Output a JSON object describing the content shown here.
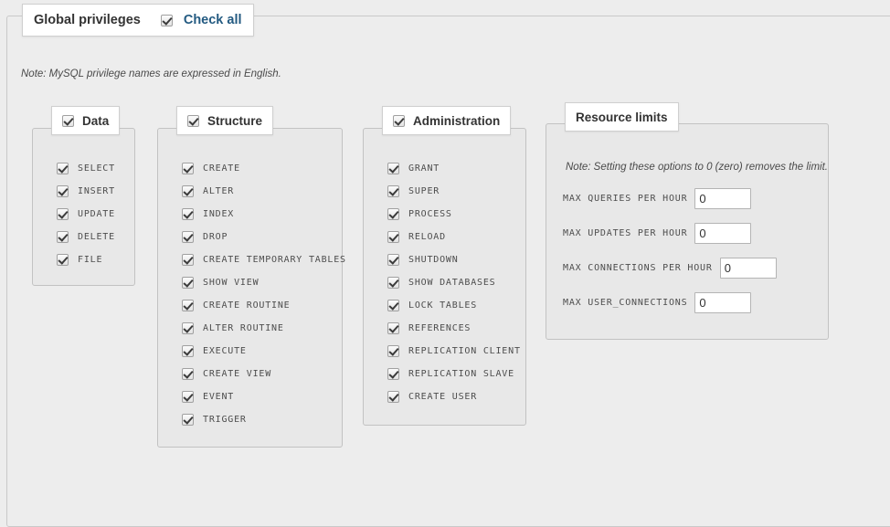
{
  "global": {
    "legend_title": "Global privileges",
    "check_all_label": "Check all",
    "check_all_checked": true,
    "note": "Note: MySQL privilege names are expressed in English."
  },
  "groups": [
    {
      "key": "data",
      "legend_title": "Data",
      "legend_checked": true,
      "items": [
        {
          "label": "SELECT",
          "checked": true
        },
        {
          "label": "INSERT",
          "checked": true
        },
        {
          "label": "UPDATE",
          "checked": true
        },
        {
          "label": "DELETE",
          "checked": true
        },
        {
          "label": "FILE",
          "checked": true
        }
      ]
    },
    {
      "key": "structure",
      "legend_title": "Structure",
      "legend_checked": true,
      "items": [
        {
          "label": "CREATE",
          "checked": true
        },
        {
          "label": "ALTER",
          "checked": true
        },
        {
          "label": "INDEX",
          "checked": true
        },
        {
          "label": "DROP",
          "checked": true
        },
        {
          "label": "CREATE TEMPORARY TABLES",
          "checked": true
        },
        {
          "label": "SHOW VIEW",
          "checked": true
        },
        {
          "label": "CREATE ROUTINE",
          "checked": true
        },
        {
          "label": "ALTER ROUTINE",
          "checked": true
        },
        {
          "label": "EXECUTE",
          "checked": true
        },
        {
          "label": "CREATE VIEW",
          "checked": true
        },
        {
          "label": "EVENT",
          "checked": true
        },
        {
          "label": "TRIGGER",
          "checked": true
        }
      ]
    },
    {
      "key": "administration",
      "legend_title": "Administration",
      "legend_checked": true,
      "items": [
        {
          "label": "GRANT",
          "checked": true
        },
        {
          "label": "SUPER",
          "checked": true
        },
        {
          "label": "PROCESS",
          "checked": true
        },
        {
          "label": "RELOAD",
          "checked": true
        },
        {
          "label": "SHUTDOWN",
          "checked": true
        },
        {
          "label": "SHOW DATABASES",
          "checked": true
        },
        {
          "label": "LOCK TABLES",
          "checked": true
        },
        {
          "label": "REFERENCES",
          "checked": true
        },
        {
          "label": "REPLICATION CLIENT",
          "checked": true
        },
        {
          "label": "REPLICATION SLAVE",
          "checked": true
        },
        {
          "label": "CREATE USER",
          "checked": true
        }
      ]
    }
  ],
  "resource_limits": {
    "legend_title": "Resource limits",
    "note": "Note: Setting these options to 0 (zero) removes the limit.",
    "fields": [
      {
        "label": "MAX QUERIES PER HOUR",
        "value": "0"
      },
      {
        "label": "MAX UPDATES PER HOUR",
        "value": "0"
      },
      {
        "label": "MAX CONNECTIONS PER HOUR",
        "value": "0"
      },
      {
        "label": "MAX USER_CONNECTIONS",
        "value": "0"
      }
    ]
  },
  "colors": {
    "page_background": "#ededed",
    "panel_background": "#e8e8e8",
    "border": "#c2c2c2",
    "link": "#235a81",
    "label_text": "#4d4d4d",
    "title_text": "#333333"
  }
}
